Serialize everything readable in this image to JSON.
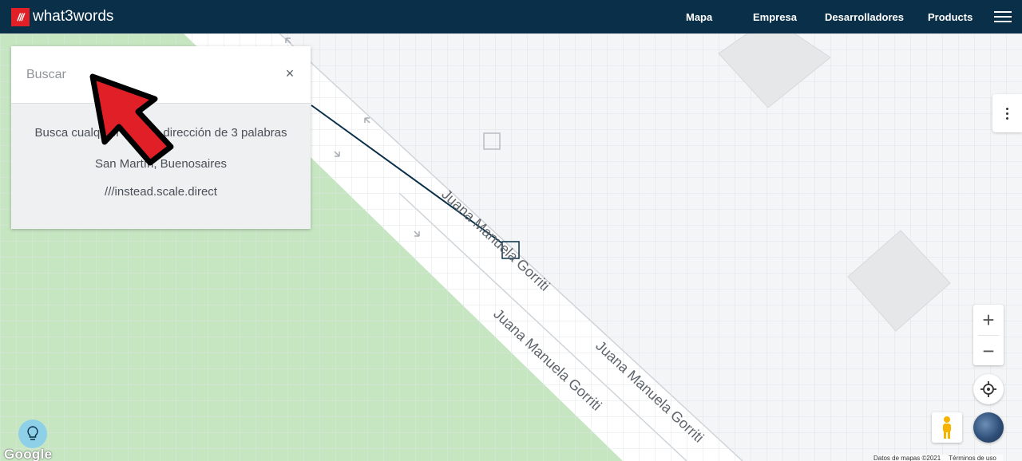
{
  "header": {
    "logo_mark": "///",
    "logo_text": "what3words",
    "nav": [
      "Mapa",
      "Empresa",
      "Desarrolladores",
      "Products"
    ]
  },
  "search": {
    "placeholder": "Buscar",
    "value": "",
    "hints": [
      "Busca cualquier lugar o dirección de 3 palabras",
      "San Martín, Buenosaires",
      "///instead.scale.direct"
    ]
  },
  "map": {
    "street_labels": [
      "Juana Manuela Gorriti",
      "Juana Manuela Gorriti",
      "Juana Manuela Gorriti"
    ],
    "google_label": "Google",
    "attribution": [
      "Datos de mapas ©2021",
      "Términos de uso"
    ],
    "colors": {
      "park": "#c6e6c2",
      "background": "#f4f5f7",
      "grid": "#dfe2e6",
      "road": "#ffffff",
      "selected": "#0a3049"
    }
  },
  "controls": {
    "zoom_in": "+",
    "zoom_out": "−",
    "icons": [
      "more-vertical-icon",
      "locate-icon",
      "pegman-icon",
      "globe-icon",
      "lightbulb-icon",
      "close-icon"
    ]
  }
}
